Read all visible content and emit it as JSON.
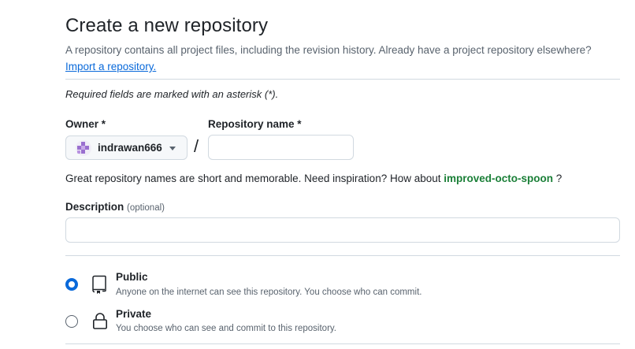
{
  "header": {
    "title": "Create a new repository",
    "subtitle": "A repository contains all project files, including the revision history. Already have a project repository elsewhere?",
    "import_link": "Import a repository."
  },
  "required_note": "Required fields are marked with an asterisk (*).",
  "owner": {
    "label": "Owner *",
    "value": "indrawan666"
  },
  "separator": "/",
  "repo_name": {
    "label": "Repository name *",
    "value": ""
  },
  "hint": {
    "text": "Great repository names are short and memorable. Need inspiration? How about",
    "suggestion": "improved-octo-spoon",
    "suffix": "?"
  },
  "description": {
    "label": "Description",
    "optional": "(optional)",
    "value": ""
  },
  "visibility": {
    "selected": "public",
    "public": {
      "title": "Public",
      "desc": "Anyone on the internet can see this repository. You choose who can commit.",
      "icon": "repo-icon"
    },
    "private": {
      "title": "Private",
      "desc": "You choose who can see and commit to this repository.",
      "icon": "lock-icon"
    }
  },
  "colors": {
    "accent": "#0969da",
    "suggestion": "#1a7f37",
    "muted": "#59636e",
    "border": "#d1d9e0"
  }
}
